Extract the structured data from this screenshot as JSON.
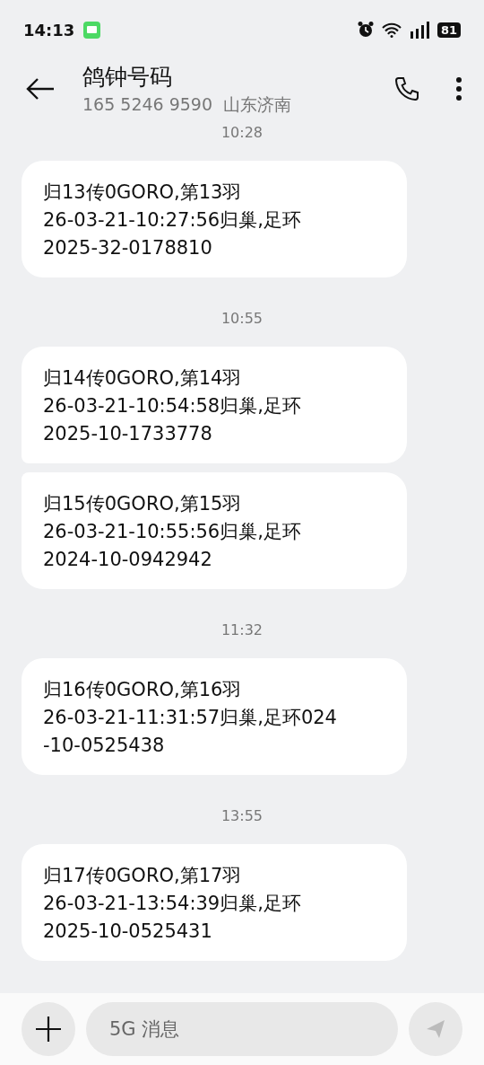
{
  "status_bar": {
    "time": "14:13"
  },
  "header": {
    "title": "鸽钟号码",
    "subtitle": "165 5246 9590  山东济南"
  },
  "groups": [
    {
      "time": "10:28",
      "messages": [
        {
          "text": "归13传0GORO,第13羽\n26-03-21-10:27:56归巢,足环\n2025-32-0178810"
        }
      ]
    },
    {
      "time": "10:55",
      "messages": [
        {
          "text": "归14传0GORO,第14羽\n26-03-21-10:54:58归巢,足环\n2025-10-1733778"
        },
        {
          "text": "归15传0GORO,第15羽\n26-03-21-10:55:56归巢,足环\n2024-10-0942942"
        }
      ]
    },
    {
      "time": "11:32",
      "messages": [
        {
          "text": "归16传0GORO,第16羽\n26-03-21-11:31:57归巢,足环024\n-10-0525438"
        }
      ]
    },
    {
      "time": "13:55",
      "messages": [
        {
          "text": "归17传0GORO,第17羽\n26-03-21-13:54:39归巢,足环\n2025-10-0525431"
        }
      ]
    }
  ],
  "composer": {
    "placeholder": "5G 消息"
  },
  "battery": {
    "label": "81"
  }
}
